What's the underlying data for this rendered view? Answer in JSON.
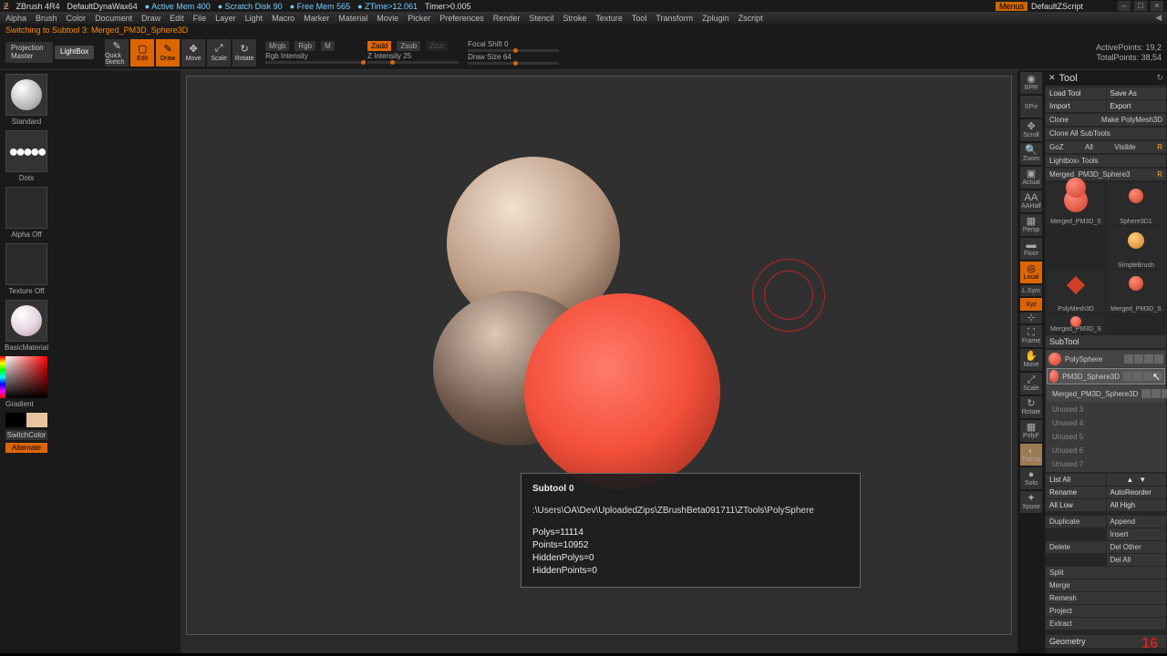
{
  "titlebar": {
    "product": "ZBrush 4R4",
    "document": "DefaultDynaWax64",
    "active_mem": "Active Mem 400",
    "scratch": "Scratch Disk 90",
    "free_mem": "Free Mem 565",
    "ztime": "ZTime>12.061",
    "timer": "Timer>0.005",
    "menus": "Menus",
    "script": "DefaultZScript",
    "min": "–",
    "max": "□",
    "close": "×"
  },
  "menubar": [
    "Alpha",
    "Brush",
    "Color",
    "Document",
    "Draw",
    "Edit",
    "File",
    "Layer",
    "Light",
    "Macro",
    "Marker",
    "Material",
    "Movie",
    "Picker",
    "Preferences",
    "Render",
    "Stencil",
    "Stroke",
    "Texture",
    "Tool",
    "Transform",
    "Zplugin",
    "Zscript"
  ],
  "statusline": "Switching to Subtool 3:  Merged_PM3D_Sphere3D",
  "toolbar": {
    "proj_master": "Projection Master",
    "lightbox": "LightBox",
    "quick_sketch": "Quick Sketch",
    "edit": "Edit",
    "draw": "Draw",
    "move": "Move",
    "scale": "Scale",
    "rotate": "Rotate",
    "mrgb": "Mrgb",
    "rgb": "Rgb",
    "m": "M",
    "rgb_intensity": "Rgb Intensity",
    "zadd": "Zadd",
    "zsub": "Zsub",
    "zcut": "Zcut",
    "zintensity": "Z Intensity 25",
    "focal": "Focal Shift 0",
    "drawsize": "Draw Size 64",
    "active": "ActivePoints: 19,2",
    "total": "TotalPoints: 38,54"
  },
  "left": {
    "brush": "Standard",
    "stroke": "Dots",
    "alpha": "Alpha Off",
    "texture": "Texture Off",
    "material": "BasicMaterial",
    "gradient": "Gradient",
    "switch": "SwitchColor",
    "alternate": "Alternate"
  },
  "right_shelf": [
    "BPR",
    "SPix",
    "Scroll",
    "Zoom",
    "Actual",
    "AAHalf",
    "Persp",
    "Floor",
    "Local",
    "L.Sym",
    "Xyz",
    "",
    "Frame",
    "Move",
    "Scale",
    "Rotate",
    "PolyF",
    "Transp",
    "Solo",
    "Xpose"
  ],
  "tooltip": {
    "title": "Subtool 0",
    "path": ":\\Users\\OA\\Dev\\UploadedZips\\ZBrushBeta091711\\ZTools\\PolySphere",
    "l1": "Polys=11114",
    "l2": "Points=10952",
    "l3": "HiddenPolys=0",
    "l4": "HiddenPoints=0"
  },
  "rp": {
    "title": "Tool",
    "load": "Load Tool",
    "save": "Save As",
    "import": "Import",
    "export": "Export",
    "clone": "Clone",
    "make": "Make PolyMesh3D",
    "cloneall": "Clone All SubTools",
    "goz": "GoZ",
    "all": "All",
    "visible": "Visible",
    "r": "R",
    "lightbox": "Lightbox› Tools",
    "current": "Merged_PM3D_Sphere3",
    "cur_r": "R",
    "thumbs": [
      "Merged_PM3D_S",
      "Sphere3D1",
      "SimpleBrush",
      "PolyMesh3D",
      "Merged_PM3D_S",
      "Merged_PM3D_S"
    ],
    "subtool_head": "SubTool",
    "subtools": [
      "PolySphere",
      "PM3D_Sphere3D",
      "Merged_PM3D_Sphere3D"
    ],
    "unused": [
      "Unused 3",
      "Unused 4",
      "Unused 5",
      "Unused 6",
      "Unused 7"
    ],
    "listall": "List All",
    "rename": "Rename",
    "autoreorder": "AutoReorder",
    "alllow": "All Low",
    "allhigh": "All High",
    "duplicate": "Duplicate",
    "append": "Append",
    "insert": "Insert",
    "delete": "Delete",
    "delother": "Del Other",
    "delall": "Del All",
    "split": "Split",
    "merge": "Merge",
    "remesh": "Remesh",
    "project": "Project",
    "extract": "Extract",
    "geometry": "Geometry"
  },
  "corner": "16"
}
